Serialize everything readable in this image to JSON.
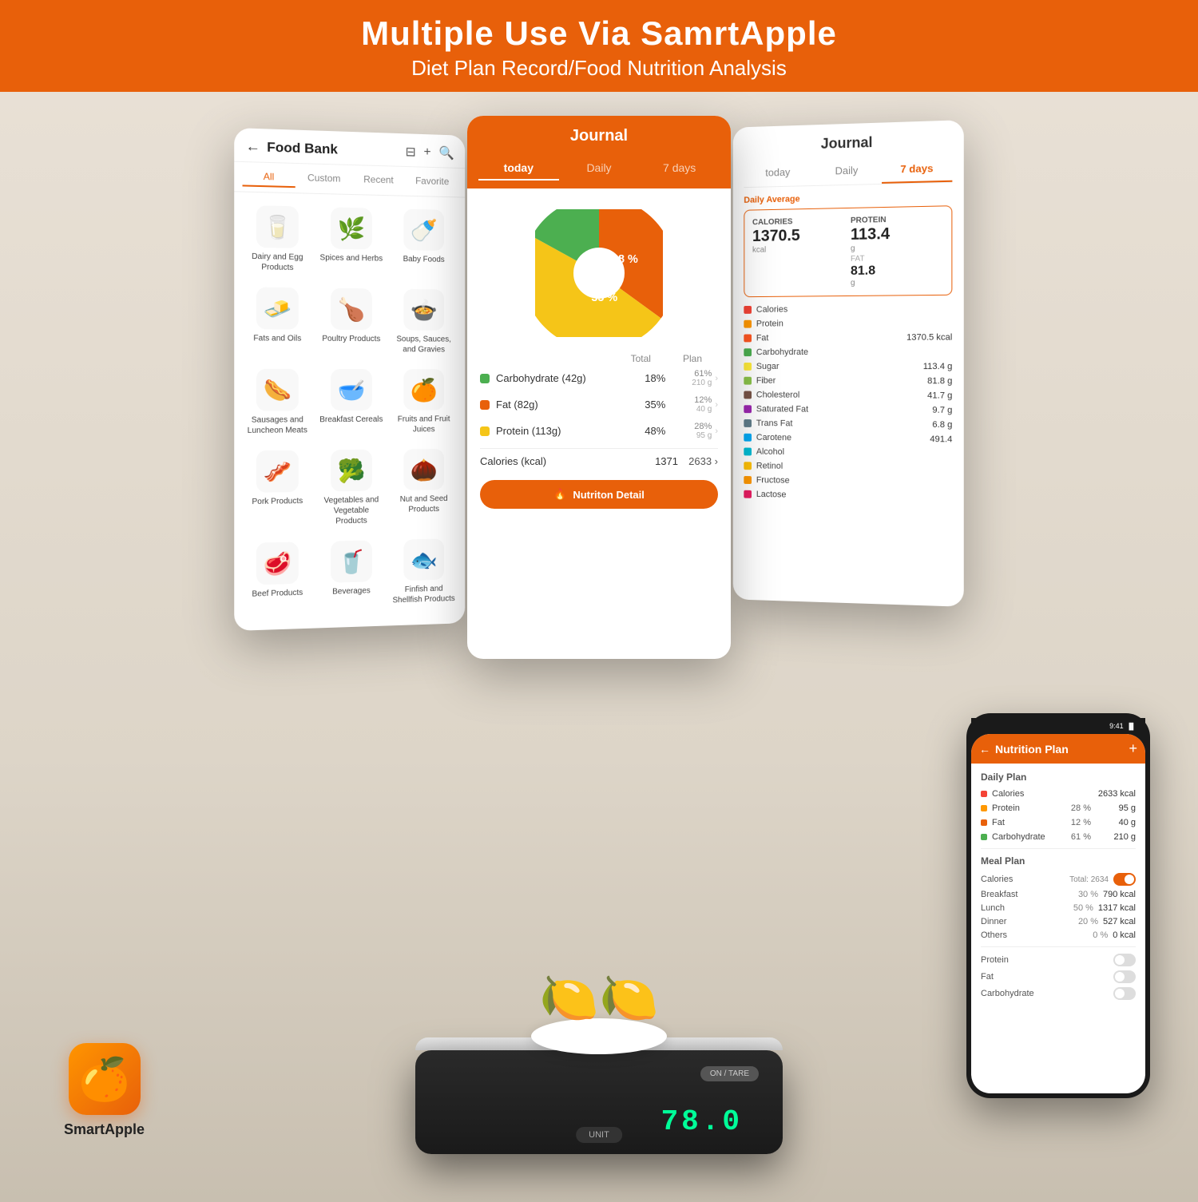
{
  "header": {
    "title": "Multiple Use Via SamrtApple",
    "subtitle": "Diet Plan Record/Food Nutrition Analysis",
    "bg_color": "#E8600A"
  },
  "food_bank": {
    "title": "Food Bank",
    "tabs": [
      "All",
      "Custom",
      "Recent",
      "Favorite"
    ],
    "active_tab": "All",
    "items": [
      {
        "label": "Dairy and Egg Products",
        "icon": "🥛"
      },
      {
        "label": "Spices and Herbs",
        "icon": "🌿"
      },
      {
        "label": "Baby Foods",
        "icon": "🍼"
      },
      {
        "label": "Fats and Oils",
        "icon": "🧈"
      },
      {
        "label": "Poultry Products",
        "icon": "🍗"
      },
      {
        "label": "Soups, Sauces, and Gravies",
        "icon": "🍲"
      },
      {
        "label": "Sausages and Luncheon Meats",
        "icon": "🥩"
      },
      {
        "label": "Breakfast Cereals",
        "icon": "🥣"
      },
      {
        "label": "Fruits and Fruit Juices",
        "icon": "🍊"
      },
      {
        "label": "Pork Products",
        "icon": "🥓"
      },
      {
        "label": "Vegetables and Vegetable Products",
        "icon": "🥦"
      },
      {
        "label": "Nut and Seed Products",
        "icon": "🥜"
      },
      {
        "label": "Beef Products",
        "icon": "🥩"
      },
      {
        "label": "Beverages",
        "icon": "🥤"
      },
      {
        "label": "Finfish and Shellfish Products",
        "icon": "🐟"
      }
    ]
  },
  "journal": {
    "title": "Journal",
    "tabs": [
      "today",
      "Daily",
      "7 days"
    ],
    "active_tab": "today",
    "pie_chart": {
      "carb_pct": 48,
      "protein_pct": 18,
      "fat_pct": 35,
      "carb_color": "#f5c518",
      "protein_color": "#4caf50",
      "fat_color": "#E8600A"
    },
    "header_row": {
      "total_label": "Total",
      "plan_label": "Plan"
    },
    "rows": [
      {
        "color": "#4caf50",
        "name": "Carbohydrate (42g)",
        "pct": "18%",
        "plan": "61%",
        "plan_sub": "210 g"
      },
      {
        "color": "#E8600A",
        "name": "Fat (82g)",
        "pct": "35%",
        "plan": "12%",
        "plan_sub": "40 g"
      },
      {
        "color": "#f5c518",
        "name": "Protein (113g)",
        "pct": "48%",
        "plan": "28%",
        "plan_sub": "95 g"
      }
    ],
    "calories": {
      "label": "Calories (kcal)",
      "total": "1371",
      "plan": "2633"
    },
    "detail_btn": "Nutriton Detail"
  },
  "journal_7days": {
    "title": "Journal",
    "tabs": [
      "today",
      "Daily",
      "7 days"
    ],
    "active_tab": "7 days",
    "daily_avg_label": "Daily Average",
    "stats": {
      "calories_label": "CALORIES",
      "calories_value": "1370.5",
      "calories_unit": "kcal",
      "protein_label": "PROTEIN",
      "protein_value": "113.4",
      "protein_unit": "g",
      "fat_label": "FAT",
      "fat_value": "81.8",
      "fat_unit": "g"
    },
    "nutrients": [
      {
        "color": "#f44336",
        "name": "Calories",
        "value": ""
      },
      {
        "color": "#ff9800",
        "name": "Protein",
        "value": ""
      },
      {
        "color": "#ff5722",
        "name": "Fat",
        "value": "1370.5 kcal"
      },
      {
        "color": "#4caf50",
        "name": "Carbohydrate",
        "value": ""
      },
      {
        "color": "#ffeb3b",
        "name": "Sugar",
        "value": "113.4 g"
      },
      {
        "color": "#8bc34a",
        "name": "Fiber",
        "value": "81.8 g"
      },
      {
        "color": "#795548",
        "name": "Cholesterol",
        "value": "41.7 g"
      },
      {
        "color": "#9c27b0",
        "name": "Saturated Fat",
        "value": "9.7 g"
      },
      {
        "color": "#607d8b",
        "name": "Trans Fat",
        "value": "6.8 g"
      },
      {
        "color": "#03a9f4",
        "name": "Carotene",
        "value": "491.4"
      },
      {
        "color": "#00bcd4",
        "name": "Alcohol",
        "value": ""
      },
      {
        "color": "#ffc107",
        "name": "Retinol",
        "value": ""
      },
      {
        "color": "#ff9800",
        "name": "Fructose",
        "value": ""
      },
      {
        "color": "#e91e63",
        "name": "Lactose",
        "value": ""
      }
    ]
  },
  "scale": {
    "display": "78.0",
    "unit_btn": "UNIT",
    "on_tare_btn": "ON / TARE"
  },
  "smartapple": {
    "logo_text": "SmartApple"
  },
  "nutrition_plan": {
    "title": "Nutrition Plan",
    "daily_plan_label": "Daily Plan",
    "plus_btn": "+",
    "rows": [
      {
        "color": "#f44336",
        "label": "Calories",
        "pct": "",
        "value": "2633 kcal"
      },
      {
        "color": "#ff9800",
        "label": "Protein",
        "pct": "28 %",
        "value": "95 g"
      },
      {
        "color": "#E8600A",
        "label": "Fat",
        "pct": "12 %",
        "value": "40 g"
      },
      {
        "color": "#4caf50",
        "label": "Carbohydrate",
        "pct": "61 %",
        "value": "210 g"
      }
    ],
    "meal_plan_label": "Meal Plan",
    "meal_rows": [
      {
        "label": "Calories",
        "note": "Total: 2634",
        "toggle": true
      },
      {
        "label": "Breakfast",
        "pct": "30 %",
        "value": "790 kcal"
      },
      {
        "label": "Lunch",
        "pct": "50 %",
        "value": "1317 kcal"
      },
      {
        "label": "Dinner",
        "pct": "20 %",
        "value": "527 kcal"
      },
      {
        "label": "Others",
        "pct": "0 %",
        "value": "0 kcal"
      }
    ],
    "toggle_rows": [
      {
        "label": "Protein",
        "toggle_on": false
      },
      {
        "label": "Fat",
        "toggle_on": false
      },
      {
        "label": "Carbohydrate",
        "toggle_on": false
      }
    ]
  }
}
